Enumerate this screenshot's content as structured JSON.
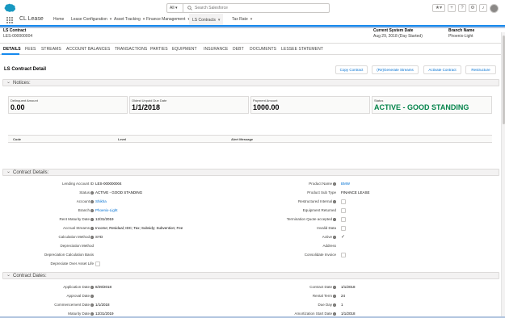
{
  "app": {
    "name": "CL Lease"
  },
  "search": {
    "scope": "All",
    "placeholder": "Search Salesforce"
  },
  "nav": [
    {
      "label": "Home"
    },
    {
      "label": "Lease Configuration"
    },
    {
      "label": "Asset Tracking"
    },
    {
      "label": "Finance Management"
    },
    {
      "label": "LS Contracts"
    },
    {
      "label": "Tax Rate"
    }
  ],
  "header": {
    "title": "LS Contract",
    "contract_id": "LES-000000004",
    "system_date_label": "Current System Date",
    "system_date": "Aug 29, 2018 (Day Started)",
    "branch_label": "Branch Name",
    "branch": "Phoenix-Light"
  },
  "tabs": [
    "DETAILS",
    "FEES",
    "STREAMS",
    "ACCOUNT BALANCES",
    "TRANSACTIONS",
    "PARTIES",
    "EQUIPMENT",
    "INSURANCE",
    "DEBT",
    "DOCUMENTS",
    "LESSEE STATEMENT"
  ],
  "detail": {
    "title": "LS Contract Detail",
    "buttons": {
      "copy": "Copy Contract",
      "regen": "(Re)Generate Streams",
      "activate": "Activate Contract",
      "restructure": "Restructure"
    }
  },
  "notices": {
    "title": "Notices:",
    "delinquent_label": "Delinquent Amount",
    "delinquent_value": "0.00",
    "oldest_label": "Oldest Unpaid Due Date",
    "oldest_value": "1/1/2018",
    "payment_label": "Payment Amount",
    "payment_value": "1000.00",
    "status_label": "Status",
    "status_value": "ACTIVE - GOOD STANDING",
    "table": {
      "code": "Code",
      "level": "Level",
      "message": "Alert Message"
    }
  },
  "contract_details": {
    "title": "Contract Details:",
    "left": [
      {
        "label": "Lending Account ID",
        "value": "LES-000000004"
      },
      {
        "label": "Status",
        "value": "ACTIVE - GOOD STANDING"
      },
      {
        "label": "Account",
        "value": "Shikha"
      },
      {
        "label": "Branch",
        "value": "Phoenix-Light"
      },
      {
        "label": "Rent Maturity Date",
        "value": "12/31/2019"
      },
      {
        "label": "Accrual Streams",
        "value": "Income; Residual; IDC; Tax; Subsidy; Subvention; Fee"
      },
      {
        "label": "Calculation Method",
        "value": "SYD"
      },
      {
        "label": "Depreciation Method",
        "value": ""
      },
      {
        "label": "Depreciation Calculation Basis",
        "value": ""
      },
      {
        "label": "Depreciate Over Asset Life",
        "value": ""
      }
    ],
    "right": [
      {
        "label": "Product Name",
        "value": "BMW"
      },
      {
        "label": "Product Sub Type",
        "value": "FINANCE LEASE"
      },
      {
        "label": "Restructured Internal",
        "value": ""
      },
      {
        "label": "Equipment Returned",
        "value": ""
      },
      {
        "label": "Termination Quote accepted",
        "value": ""
      },
      {
        "label": "Invalid Data",
        "value": ""
      },
      {
        "label": "Active",
        "value": ""
      },
      {
        "label": "Address",
        "value": ""
      },
      {
        "label": "Consolidate Invoice",
        "value": ""
      }
    ]
  },
  "contract_dates": {
    "title": "Contract Dates:",
    "left": [
      {
        "label": "Application Date",
        "value": "8/29/2018"
      },
      {
        "label": "Approval Date",
        "value": ""
      },
      {
        "label": "Commencement Date",
        "value": "1/1/2018"
      },
      {
        "label": "Maturity Date",
        "value": "12/31/2019"
      }
    ],
    "right": [
      {
        "label": "Contract Date",
        "value": "1/1/2018"
      },
      {
        "label": "Rental Term",
        "value": "24"
      },
      {
        "label": "Due Day",
        "value": "1"
      },
      {
        "label": "Amortization Start Date",
        "value": "1/1/2018"
      }
    ]
  }
}
